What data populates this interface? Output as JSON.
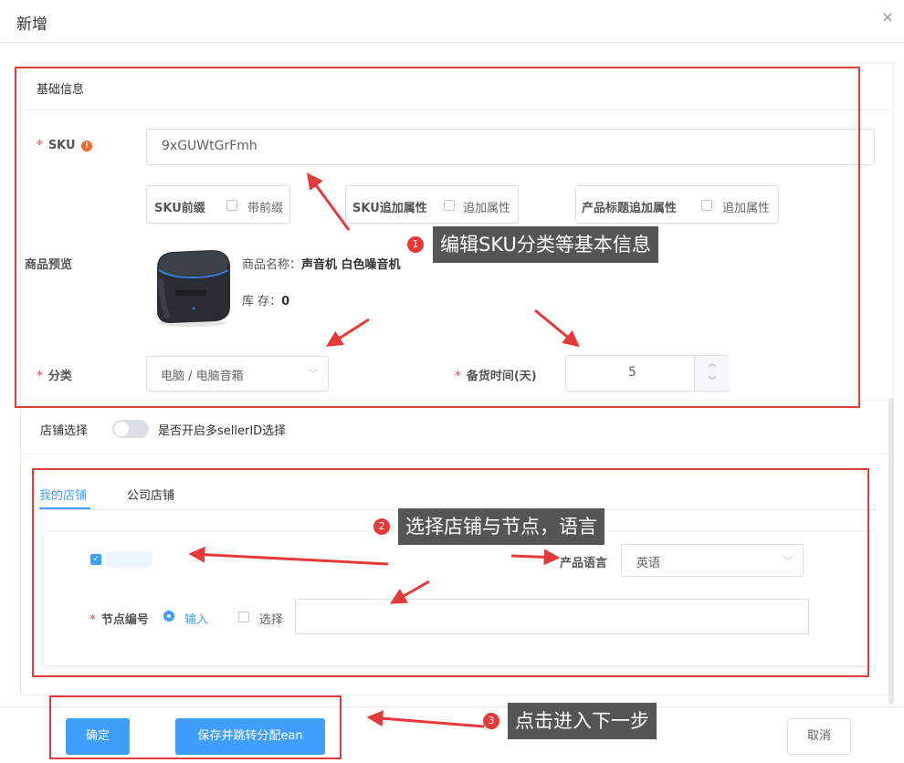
{
  "dialog": {
    "title": "新增",
    "close_icon": "×"
  },
  "basic": {
    "title": "基础信息",
    "sku_label": "SKU",
    "sku_value": "9xGUWtGrFmh",
    "prefix": {
      "label": "SKU前缀",
      "checkbox_text": "带前缀"
    },
    "append_attr": {
      "label": "SKU追加属性",
      "checkbox_text": "追加属性"
    },
    "title_attr": {
      "label": "产品标题追加属性",
      "checkbox_text": "追加属性"
    },
    "preview_label": "商品预览",
    "product_name_label": "商品名称：",
    "product_name": "声音机 白色噪音机",
    "stock_label": "库 存：",
    "stock_value": "0",
    "category_label": "分类",
    "category_value": "电脑 / 电脑音箱",
    "leadtime_label": "备货时间(天)",
    "leadtime_value": "5"
  },
  "store": {
    "label": "店铺选择",
    "toggle_text": "是否开启多sellerID选择",
    "tabs": [
      "我的店铺",
      "公司店铺"
    ],
    "lang_label": "产品语言",
    "lang_value": "英语",
    "node_label": "节点编号",
    "radio_input": "输入",
    "radio_select": "选择"
  },
  "annotations": {
    "a1": {
      "num": "1",
      "text": "编辑SKU分类等基本信息"
    },
    "a2": {
      "num": "2",
      "text": "选择店铺与节点，语言"
    },
    "a3": {
      "num": "3",
      "text": "点击进入下一步"
    }
  },
  "footer": {
    "confirm": "确定",
    "save_jump": "保存并跳转分配ean",
    "cancel": "取消"
  },
  "colors": {
    "primary": "#409eff",
    "annotation": "#e5393a",
    "callout_bg": "#555555"
  }
}
